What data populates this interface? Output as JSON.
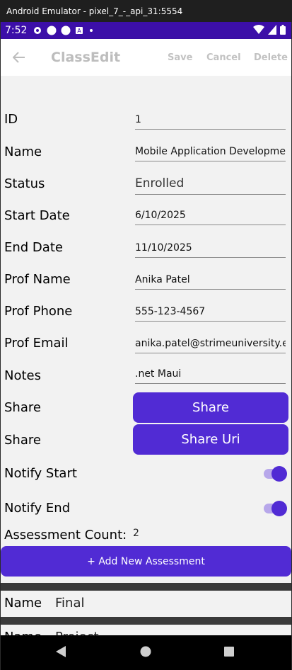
{
  "emulator": {
    "title": "Android Emulator - pixel_7_-_api_31:5554"
  },
  "status_bar": {
    "time": "7:52",
    "bg_color": "#3c0fa8"
  },
  "app_bar": {
    "title": "ClassEdit",
    "save_label": "Save",
    "cancel_label": "Cancel",
    "delete_label": "Delete"
  },
  "form": {
    "id": {
      "label": "ID",
      "value": "1"
    },
    "name": {
      "label": "Name",
      "value": "Mobile Application Development"
    },
    "status": {
      "label": "Status",
      "value": "Enrolled"
    },
    "start_date": {
      "label": "Start Date",
      "value": "6/10/2025"
    },
    "end_date": {
      "label": "End Date",
      "value": "11/10/2025"
    },
    "prof_name": {
      "label": "Prof Name",
      "value": "Anika Patel"
    },
    "prof_phone": {
      "label": "Prof Phone",
      "value": "555-123-4567"
    },
    "prof_email": {
      "label": "Prof Email",
      "value": "anika.patel@strimeuniversity.edu"
    },
    "notes": {
      "label": "Notes",
      "value": ".net Maui"
    },
    "share": {
      "label": "Share",
      "button": "Share"
    },
    "share_uri": {
      "label": "Share",
      "button": "Share Uri"
    },
    "notify_start": {
      "label": "Notify Start",
      "on": true
    },
    "notify_end": {
      "label": "Notify End",
      "on": true
    },
    "assessment_count": {
      "label": "Assessment Count:",
      "value": "2"
    }
  },
  "add_assessment_label": "+ Add New Assessment",
  "assessments": [
    {
      "label": "Name",
      "value": "Final"
    },
    {
      "label": "Name",
      "value": "Project"
    }
  ],
  "colors": {
    "accent": "#512bd4",
    "toggle_track": "#b7a7ea"
  }
}
